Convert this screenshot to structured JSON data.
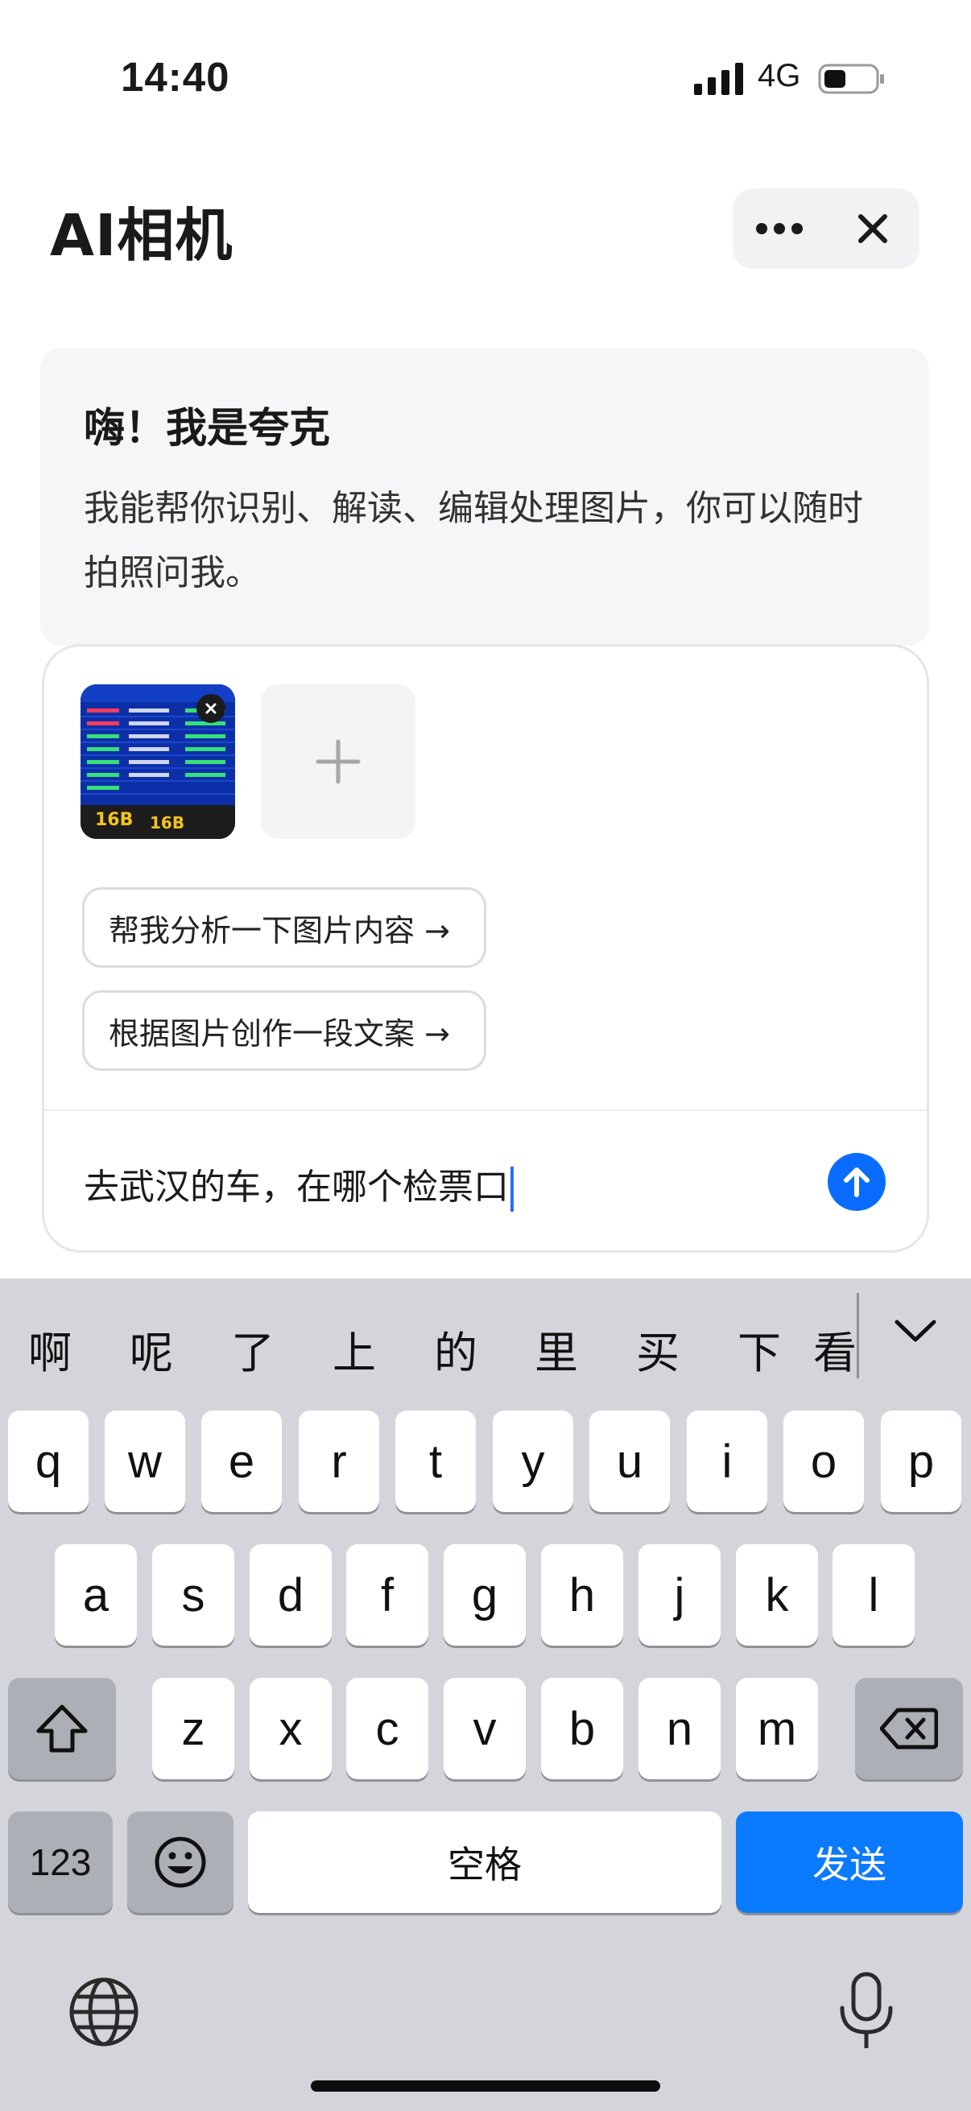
{
  "status_bar": {
    "time": "14:40",
    "network": "4G"
  },
  "header": {
    "title": "AI相机"
  },
  "greeting": {
    "title": "嗨！我是夸克",
    "body": "我能帮你识别、解读、编辑处理图片，你可以随时拍照问我。"
  },
  "thumbnail": {
    "board_labels": [
      "16B",
      "16B"
    ]
  },
  "suggestions": [
    {
      "label": "帮我分析一下图片内容 →"
    },
    {
      "label": "根据图片创作一段文案 →"
    }
  ],
  "input": {
    "value": "去武汉的车，在哪个检票口"
  },
  "keyboard": {
    "candidates": [
      "啊",
      "呢",
      "了",
      "上",
      "的",
      "里",
      "买",
      "下",
      "看"
    ],
    "row1": [
      "q",
      "w",
      "e",
      "r",
      "t",
      "y",
      "u",
      "i",
      "o",
      "p"
    ],
    "row2": [
      "a",
      "s",
      "d",
      "f",
      "g",
      "h",
      "j",
      "k",
      "l"
    ],
    "row3": [
      "z",
      "x",
      "c",
      "v",
      "b",
      "n",
      "m"
    ],
    "numbers_label": "123",
    "space_label": "空格",
    "send_label": "发送"
  },
  "colors": {
    "accent": "#0a6cff",
    "keyboard_bg": "#d3d5da",
    "send_key": "#0a7aff"
  },
  "icons": [
    "signal-icon",
    "battery-icon",
    "more-icon",
    "close-icon",
    "plus-icon",
    "send-arrow-icon",
    "shift-icon",
    "backspace-icon",
    "emoji-icon",
    "globe-icon",
    "microphone-icon",
    "chevron-down-icon"
  ]
}
